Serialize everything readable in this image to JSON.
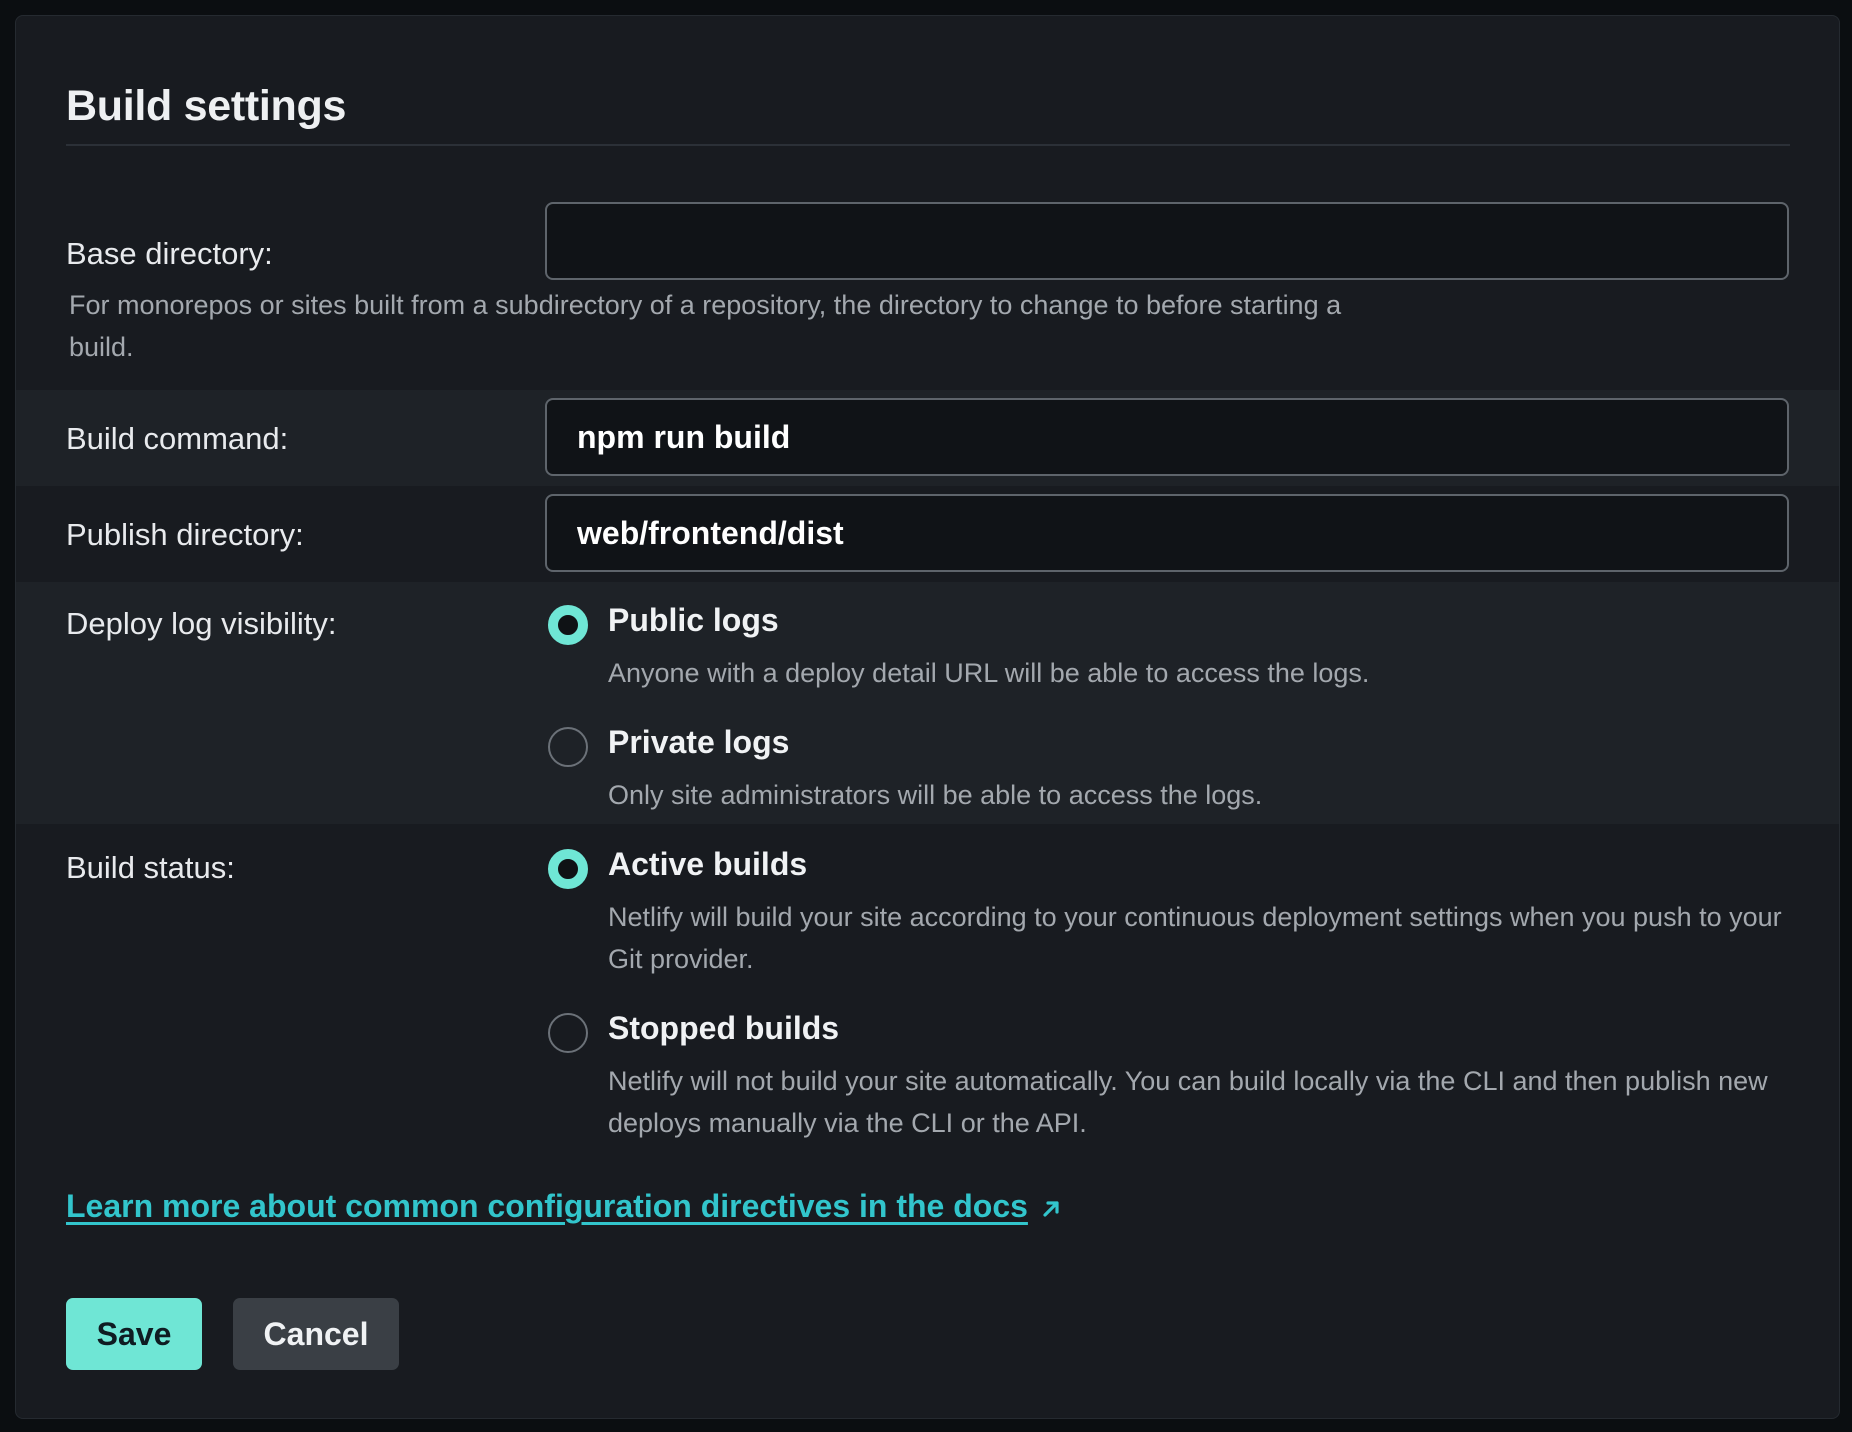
{
  "title": "Build settings",
  "fields": {
    "base_directory": {
      "label": "Base directory:",
      "value": "",
      "help": "For monorepos or sites built from a subdirectory of a repository, the directory to change to before starting a build."
    },
    "build_command": {
      "label": "Build command:",
      "value": "npm run build"
    },
    "publish_directory": {
      "label": "Publish directory:",
      "value": "web/frontend/dist"
    }
  },
  "deploy_log_visibility": {
    "label": "Deploy log visibility:",
    "options": [
      {
        "title": "Public logs",
        "description": "Anyone with a deploy detail URL will be able to access the logs.",
        "selected": true
      },
      {
        "title": "Private logs",
        "description": "Only site administrators will be able to access the logs.",
        "selected": false
      }
    ]
  },
  "build_status": {
    "label": "Build status:",
    "options": [
      {
        "title": "Active builds",
        "description": "Netlify will build your site according to your continuous deployment settings when you push to your Git provider.",
        "selected": true
      },
      {
        "title": "Stopped builds",
        "description": "Netlify will not build your site automatically. You can build locally via the CLI and then publish new deploys manually via the CLI or the API.",
        "selected": false
      }
    ]
  },
  "docs_link": {
    "text": "Learn more about common configuration directives in the docs",
    "icon": "external-arrow-icon"
  },
  "actions": {
    "save_label": "Save",
    "cancel_label": "Cancel"
  },
  "colors": {
    "background": "#0b0e11",
    "card": "#181b20",
    "band": "#1e2227",
    "accent": "#6fe6d5",
    "link": "#32c5cc",
    "muted_text": "#a3a8ae"
  }
}
